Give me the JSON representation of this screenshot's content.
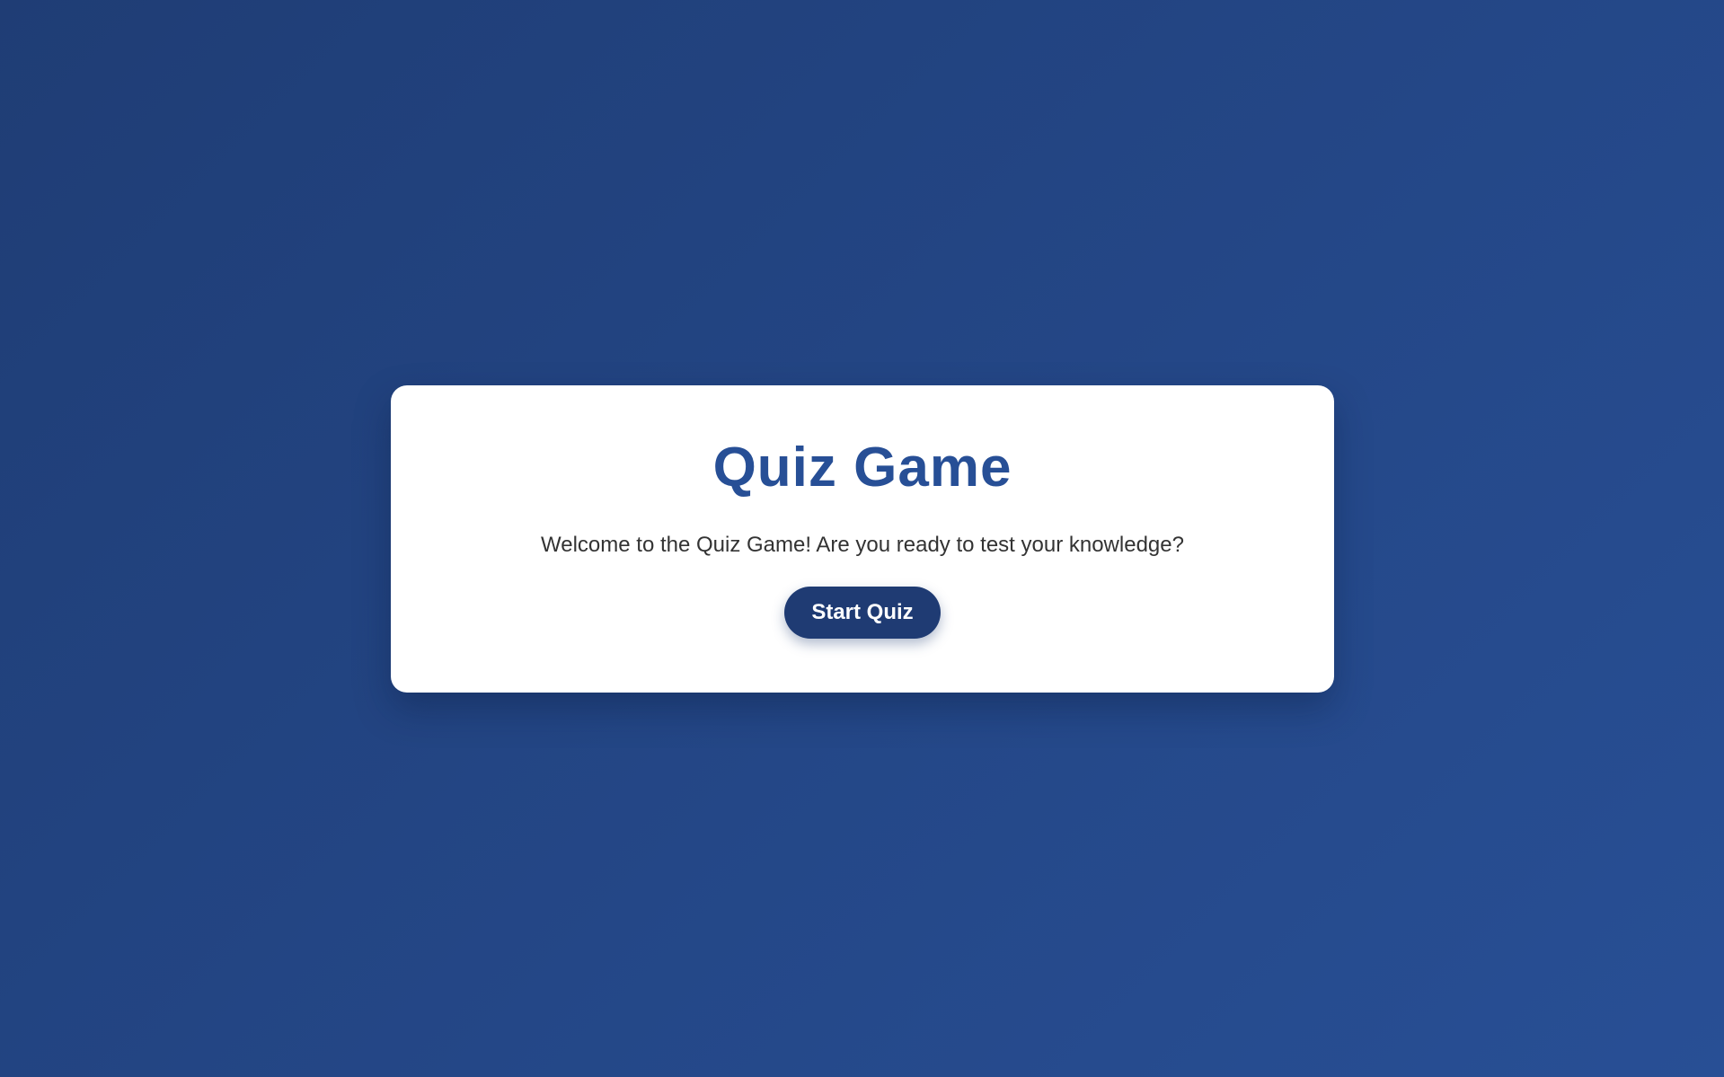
{
  "quiz": {
    "title": "Quiz Game",
    "welcome_text": "Welcome to the Quiz Game! Are you ready to test your knowledge?",
    "start_button_label": "Start Quiz"
  },
  "colors": {
    "background_start": "#1f3d75",
    "background_end": "#284f95",
    "title": "#274f96",
    "button": "#1f3b73",
    "card": "#ffffff"
  }
}
